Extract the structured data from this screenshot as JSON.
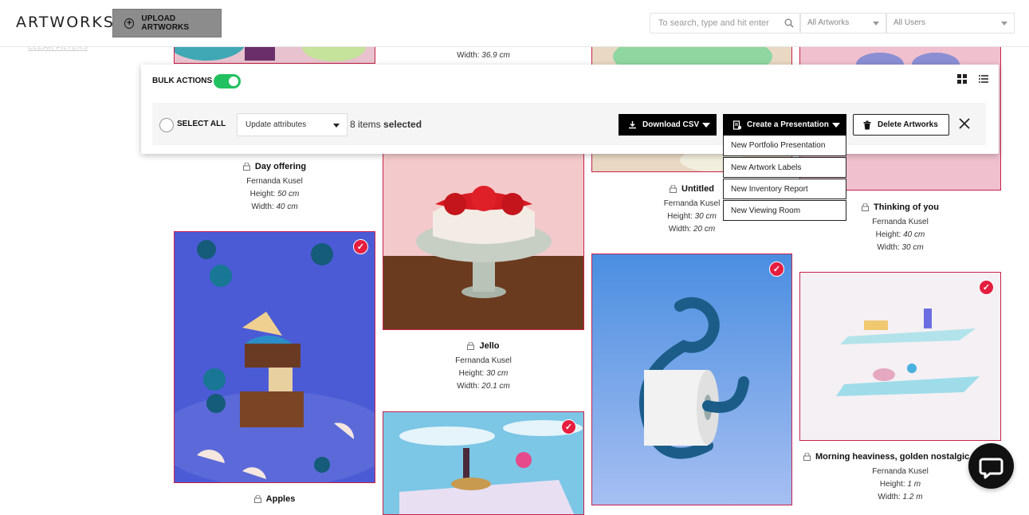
{
  "header": {
    "brand": "ARTWORKS",
    "upload_label": "UPLOAD ARTWORKS",
    "search_placeholder": "To search, type and hit enter",
    "filter_artworks": "All Artworks",
    "filter_users": "All Users",
    "left_link": "CLEAR FILTERS"
  },
  "bulk": {
    "label": "BULK ACTIONS",
    "toggle_on": true,
    "select_all": "SELECT ALL",
    "attributes_select": "Update attributes",
    "count_text": "8 items",
    "selected_word": "selected",
    "download_csv": "Download CSV",
    "create_presentation": "Create a Presentation",
    "delete": "Delete Artworks"
  },
  "presentation_menu": [
    "New Portfolio Presentation",
    "New Artwork Labels",
    "New Inventory Report",
    "New Viewing Room"
  ],
  "artworks": {
    "day_offering": {
      "title": "Day offering",
      "artist": "Fernanda Kusel",
      "height_label": "Height:",
      "height": "50 cm",
      "width_label": "Width:",
      "width": "40 cm"
    },
    "top2_width": {
      "width_label": "Width:",
      "width": "36.9 cm"
    },
    "untitled": {
      "title": "Untitled",
      "artist": "Fernanda Kusel",
      "height_label": "Height:",
      "height": "30 cm",
      "width_label": "Width:",
      "width": "20 cm"
    },
    "thinking": {
      "title": "Thinking of you",
      "artist": "Fernanda Kusel",
      "height_label": "Height:",
      "height": "40 cm",
      "width_label": "Width:",
      "width": "30 cm"
    },
    "jello": {
      "title": "Jello",
      "artist": "Fernanda Kusel",
      "height_label": "Height:",
      "height": "30 cm",
      "width_label": "Width:",
      "width": "20.1 cm"
    },
    "apples": {
      "title": "Apples"
    },
    "morning": {
      "title": "Morning heaviness, golden nostalgic enjo",
      "artist": "Fernanda Kusel",
      "height_label": "Height:",
      "height": "1 m",
      "width_label": "Width:",
      "width": "1.2 m"
    }
  },
  "colors": {
    "accent_red": "#e51e3f",
    "toggle_green": "#21c15f",
    "frame": "#c8234a"
  }
}
